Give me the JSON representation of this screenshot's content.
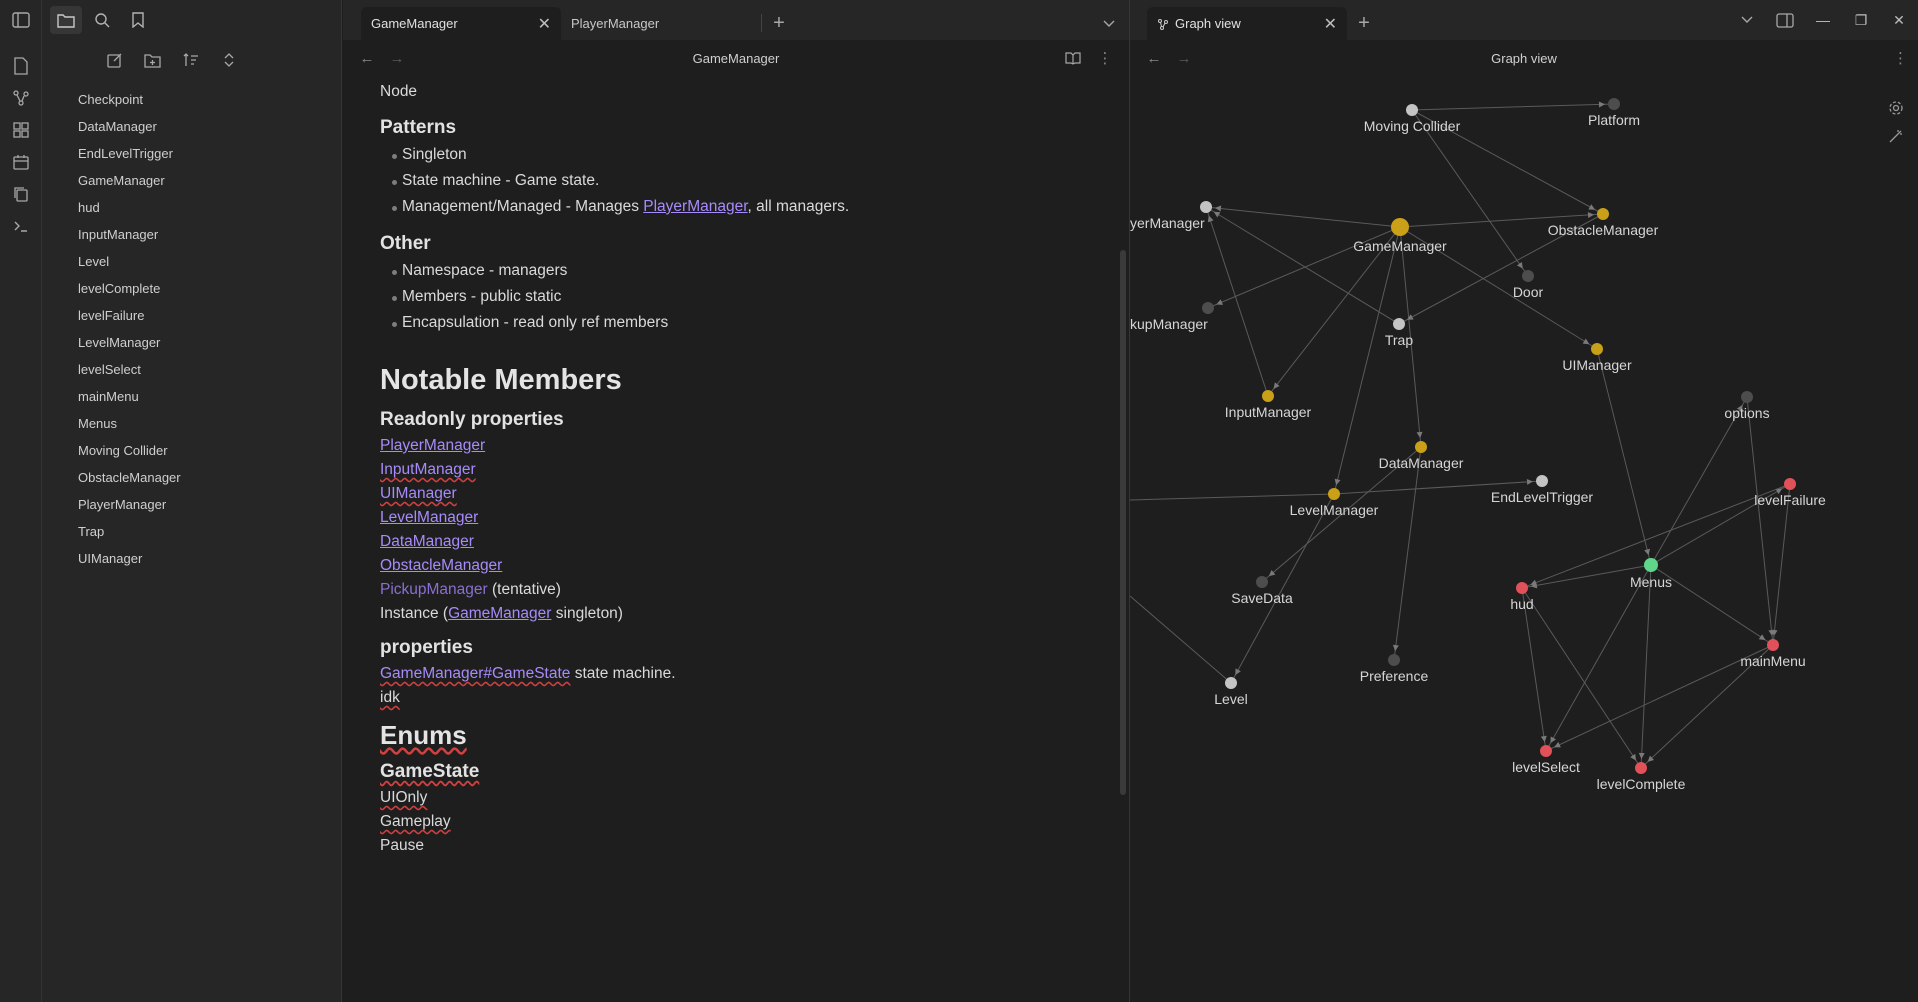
{
  "tabs_left": [
    {
      "label": "GameManager",
      "active": true
    },
    {
      "label": "PlayerManager",
      "active": false
    }
  ],
  "tab_right": {
    "label": "Graph view"
  },
  "header_left_title": "GameManager",
  "header_right_title": "Graph view",
  "files": [
    "Checkpoint",
    "DataManager",
    "EndLevelTrigger",
    "GameManager",
    "hud",
    "InputManager",
    "Level",
    "levelComplete",
    "levelFailure",
    "LevelManager",
    "levelSelect",
    "mainMenu",
    "Menus",
    "Moving Collider",
    "ObstacleManager",
    "PlayerManager",
    "Trap",
    "UIManager"
  ],
  "note": {
    "top_line": "Node",
    "patterns_heading": "Patterns",
    "patterns": {
      "item1": "Singleton",
      "item2": "State machine - Game state.",
      "item3_prefix": "Management/Managed - Manages ",
      "item3_link": "PlayerManager",
      "item3_suffix": ", all managers."
    },
    "other_heading": "Other",
    "other": [
      "Namespace - managers",
      "Members - public static",
      "Encapsulation - read only ref members"
    ],
    "notable_heading": "Notable Members",
    "readonly_heading": "Readonly properties",
    "readonly_links": [
      "PlayerManager",
      "InputManager",
      "UIManager",
      "LevelManager",
      "DataManager",
      "ObstacleManager"
    ],
    "pickup_link": "PickupManager",
    "pickup_suffix": " (tentative)",
    "instance_prefix": "Instance (",
    "instance_link": "GameManager",
    "instance_suffix": " singleton)",
    "properties_heading": "properties",
    "gamestate_link": "GameManager#GameState",
    "gamestate_suffix": " state machine.",
    "idk": "idk",
    "enums_heading": "Enums",
    "gamestate_heading": "GameState",
    "gamestate_values": [
      "UIOnly",
      "Gameplay",
      "Pause"
    ]
  },
  "graph": {
    "colors": {
      "gray": "#c4c4c4",
      "dark": "#4d4d4d",
      "gold": "#c9a018",
      "red": "#e0515a",
      "green": "#5fd68a",
      "edge": "#5a5a5a"
    },
    "nodes": [
      {
        "id": "MovingCollider",
        "label": "Moving Collider",
        "color": "gray"
      },
      {
        "id": "Platform",
        "label": "Platform",
        "color": "dark"
      },
      {
        "id": "PlayerManager",
        "label": "yerManager",
        "color": "gray"
      },
      {
        "id": "GameManager",
        "label": "GameManager",
        "color": "gold"
      },
      {
        "id": "ObstacleManager",
        "label": "ObstacleManager",
        "color": "gold"
      },
      {
        "id": "Door",
        "label": "Door",
        "color": "dark"
      },
      {
        "id": "PickupManager",
        "label": "kupManager",
        "color": "dark"
      },
      {
        "id": "Trap",
        "label": "Trap",
        "color": "gray"
      },
      {
        "id": "UIManager",
        "label": "UIManager",
        "color": "gold"
      },
      {
        "id": "InputManager",
        "label": "InputManager",
        "color": "gold"
      },
      {
        "id": "options",
        "label": "options",
        "color": "dark"
      },
      {
        "id": "DataManager",
        "label": "DataManager",
        "color": "gold"
      },
      {
        "id": "EndLevelTrigger",
        "label": "EndLevelTrigger",
        "color": "gray"
      },
      {
        "id": "levelFailure",
        "label": "levelFailure",
        "color": "red"
      },
      {
        "id": "LevelManager",
        "label": "LevelManager",
        "color": "gold"
      },
      {
        "id": "Menus",
        "label": "Menus",
        "color": "green"
      },
      {
        "id": "hud",
        "label": "hud",
        "color": "red"
      },
      {
        "id": "SaveData",
        "label": "SaveData",
        "color": "dark"
      },
      {
        "id": "mainMenu",
        "label": "mainMenu",
        "color": "red"
      },
      {
        "id": "Preference",
        "label": "Preference",
        "color": "dark"
      },
      {
        "id": "Level",
        "label": "Level",
        "color": "gray"
      },
      {
        "id": "levelSelect",
        "label": "levelSelect",
        "color": "red"
      },
      {
        "id": "levelComplete",
        "label": "levelComplete",
        "color": "red"
      }
    ]
  }
}
